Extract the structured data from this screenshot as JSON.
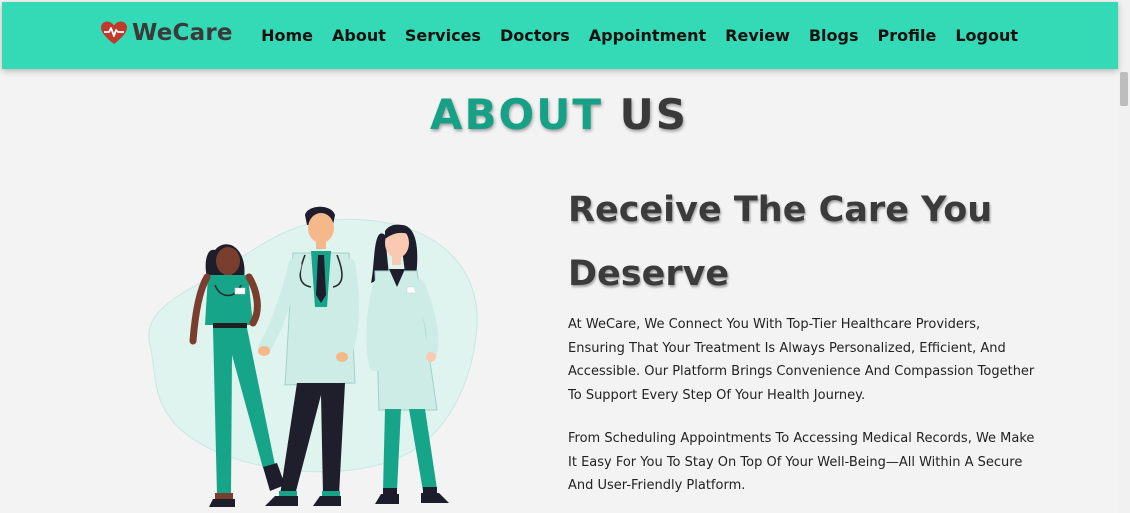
{
  "brand": {
    "name": "WeCare",
    "icon": "heart-pulse-icon"
  },
  "nav": {
    "links": [
      "Home",
      "About",
      "Services",
      "Doctors",
      "Appointment",
      "Review",
      "Blogs",
      "Profile",
      "Logout"
    ]
  },
  "section": {
    "title_part1": "ABOUT",
    "title_part2": "US"
  },
  "content": {
    "heading": "Receive The Care You Deserve",
    "paragraph1": "At WeCare, We Connect You With Top-Tier Healthcare Providers, Ensuring That Your Treatment Is Always Personalized, Efficient, And Accessible. Our Platform Brings Convenience And Compassion Together To Support Every Step Of Your Health Journey.",
    "paragraph2": "From Scheduling Appointments To Accessing Medical Records, We Make It Easy For You To Stay On Top Of Your Well-Being—All Within A Secure And User-Friendly Platform."
  },
  "colors": {
    "navbar": "#34dab5",
    "accent": "#16a085",
    "heading": "#3b3b3b",
    "logo_heart": "#c0392b"
  }
}
